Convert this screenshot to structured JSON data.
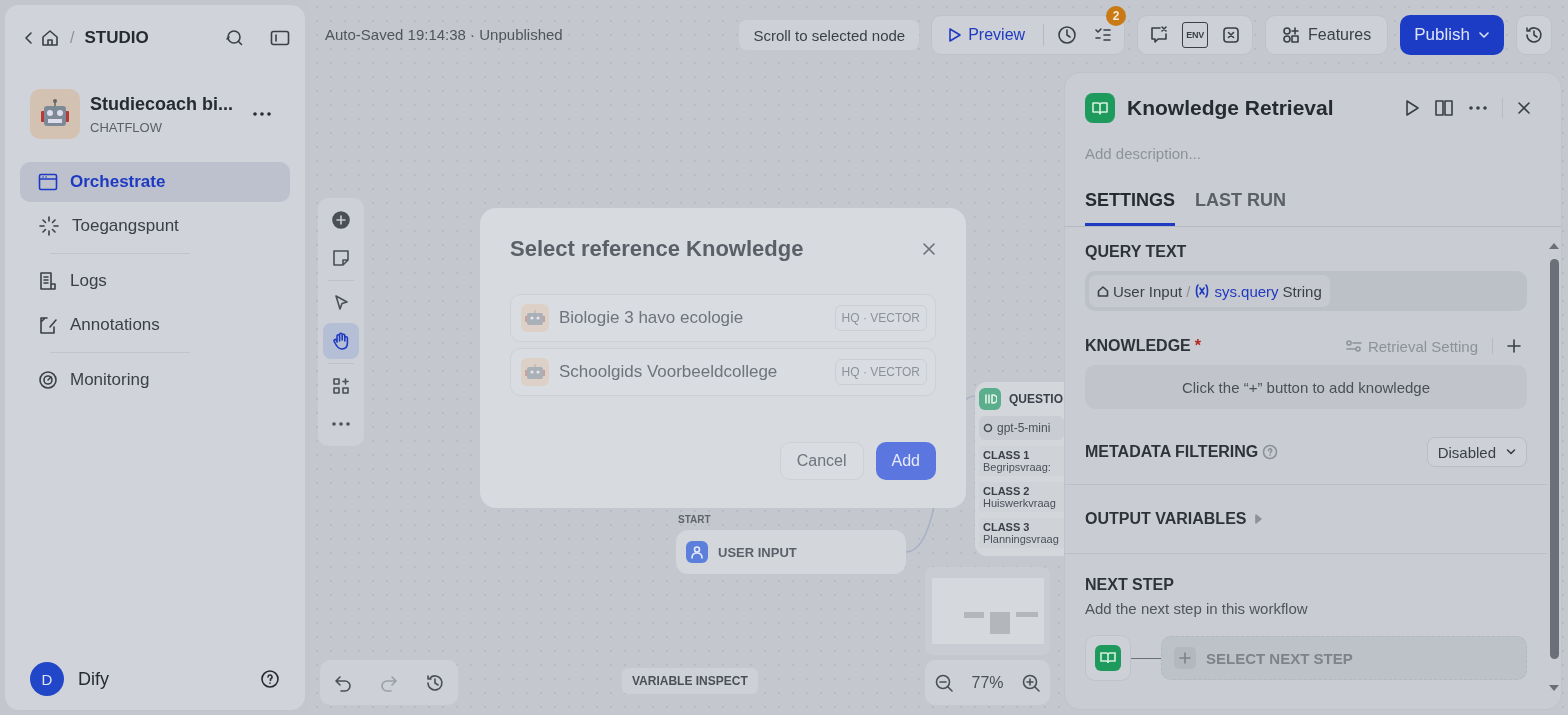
{
  "breadcrumb": {
    "separator": "/",
    "section": "STUDIO"
  },
  "app": {
    "name": "Studiecoach bi...",
    "type": "CHATFLOW"
  },
  "nav_groups": [
    {
      "items": [
        {
          "label": "Orchestrate",
          "selected": true
        },
        {
          "label": "Toegangspunt",
          "selected": false
        }
      ]
    },
    {
      "items": [
        {
          "label": "Logs",
          "selected": false
        },
        {
          "label": "Annotations",
          "selected": false
        }
      ]
    },
    {
      "items": [
        {
          "label": "Monitoring",
          "selected": false
        }
      ]
    }
  ],
  "user": {
    "initial": "D",
    "name": "Dify"
  },
  "toolbar": {
    "status": "Auto-Saved 19:14:38 · Unpublished",
    "scroll_button": "Scroll to selected node",
    "preview": "Preview",
    "checklist_count": "2",
    "env_label": "ENV",
    "features": "Features",
    "publish": "Publish"
  },
  "canvas": {
    "tools": [
      {
        "selected": false
      },
      {
        "selected": false
      },
      {
        "selected": false
      },
      {
        "selected": true
      },
      {
        "selected": false
      },
      {
        "selected": false
      }
    ],
    "start_node": {
      "caption": "START",
      "title": "USER INPUT"
    },
    "classifier_node": {
      "title": "QUESTIO",
      "model": "gpt-5-mini",
      "classes": [
        {
          "label": "CLASS 1",
          "text": "Begripsvraag:"
        },
        {
          "label": "CLASS 2",
          "text": "Huiswerkvraag"
        },
        {
          "label": "CLASS 3",
          "text": "Planningsvraag"
        }
      ]
    },
    "variable_inspect": "VARIABLE INSPECT",
    "zoom": "77%"
  },
  "modal": {
    "title": "Select reference Knowledge",
    "items": [
      {
        "name": "Biologie 3 havo ecologie",
        "badge": "HQ · VECTOR"
      },
      {
        "name": "Schoolgids Voorbeeldcollege",
        "badge": "HQ · VECTOR"
      }
    ],
    "cancel": "Cancel",
    "add": "Add"
  },
  "panel": {
    "title": "Knowledge Retrieval",
    "description_placeholder": "Add description...",
    "tabs": [
      {
        "label": "SETTINGS",
        "selected": true
      },
      {
        "label": "LAST RUN",
        "selected": false
      }
    ],
    "query_text": {
      "label": "QUERY TEXT",
      "node": "User Input",
      "separator": "/",
      "variable": "sys.query",
      "type": "String"
    },
    "knowledge": {
      "label": "KNOWLEDGE",
      "required": "*",
      "retrieval_setting": "Retrieval Setting",
      "empty": "Click the “+” button to add knowledge"
    },
    "metadata": {
      "label": "METADATA FILTERING",
      "value": "Disabled"
    },
    "output_variables": {
      "label": "OUTPUT VARIABLES",
      "expanded": false
    },
    "next_step": {
      "label": "NEXT STEP",
      "hint": "Add the next step in this workflow",
      "button": "SELECT NEXT STEP"
    }
  }
}
